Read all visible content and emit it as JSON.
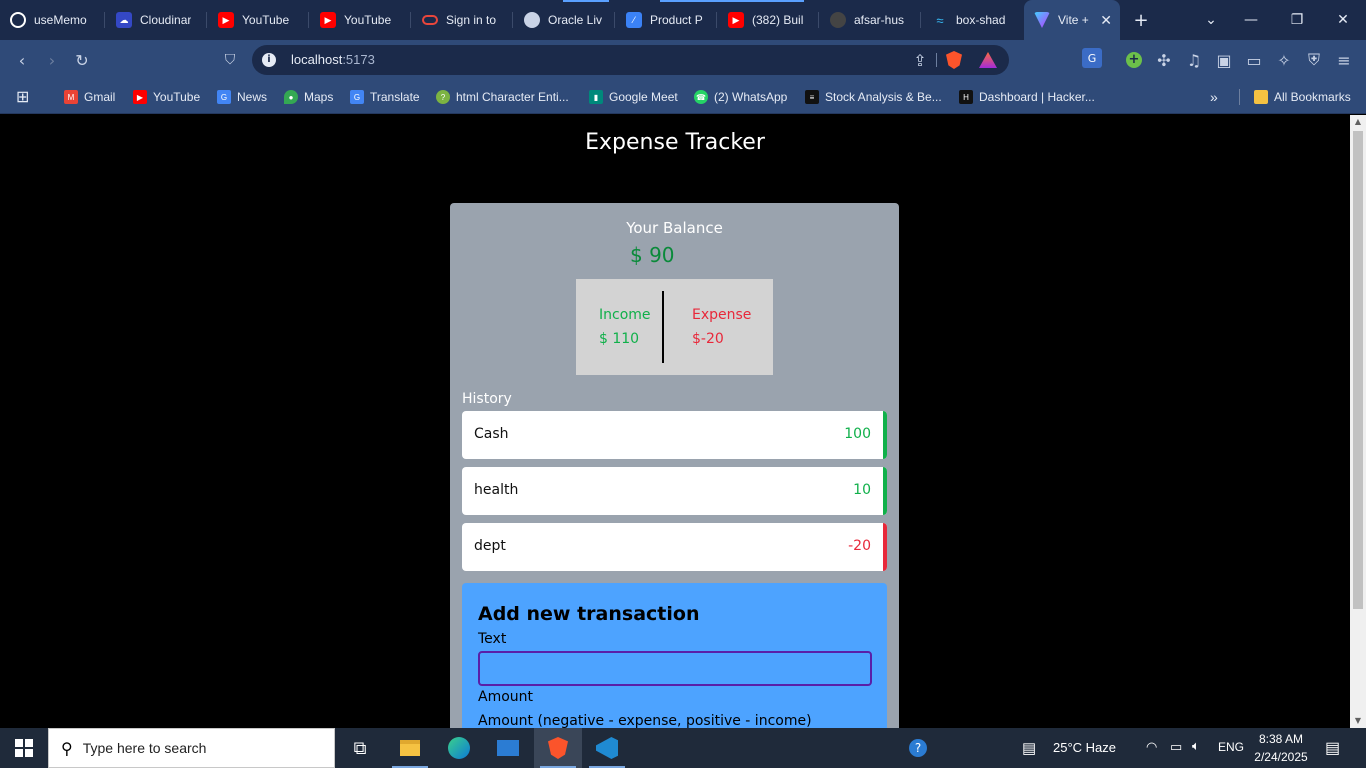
{
  "browser": {
    "tabs": [
      {
        "label": "useMemo",
        "icon": "openai-icon",
        "color": "#ffffff"
      },
      {
        "label": "Cloudinar",
        "icon": "cloudinary-icon",
        "color": "#3448c5"
      },
      {
        "label": "YouTube",
        "icon": "youtube-icon",
        "color": "#ff0000"
      },
      {
        "label": "YouTube",
        "icon": "youtube-icon",
        "color": "#ff0000"
      },
      {
        "label": "Sign in to",
        "icon": "oracle-icon",
        "color": "#e8463c"
      },
      {
        "label": "Oracle Liv",
        "icon": "globe-icon",
        "color": "#c9d3e6"
      },
      {
        "label": "Product P",
        "icon": "product-icon",
        "color": "#3b82f6"
      },
      {
        "label": "(382) Buil",
        "icon": "youtube-icon",
        "color": "#ff0000"
      },
      {
        "label": "afsar-hus",
        "icon": "github-icon",
        "color": "#444444"
      },
      {
        "label": "box-shad",
        "icon": "tailwind-icon",
        "color": "#38bdf8"
      },
      {
        "label": "Vite + ",
        "icon": "vite-icon",
        "color": "#a855f7"
      }
    ],
    "new_tab": "+",
    "address": {
      "host": "localhost",
      "port": ":5173"
    },
    "bookmarks": [
      {
        "label": "Gmail",
        "color": "#ea4335",
        "glyph": "M"
      },
      {
        "label": "YouTube",
        "color": "#ff0000",
        "glyph": "▶"
      },
      {
        "label": "News",
        "color": "#4285f4",
        "glyph": "G"
      },
      {
        "label": "Maps",
        "color": "#34a853",
        "glyph": "●"
      },
      {
        "label": "Translate",
        "color": "#4285f4",
        "glyph": "G"
      },
      {
        "label": "html Character Enti...",
        "color": "#7cb342",
        "glyph": "?"
      },
      {
        "label": "Google Meet",
        "color": "#00897b",
        "glyph": "▮"
      },
      {
        "label": "(2) WhatsApp",
        "color": "#25d366",
        "glyph": "☎"
      },
      {
        "label": "Stock Analysis & Be...",
        "color": "#111111",
        "glyph": "≡"
      },
      {
        "label": "Dashboard | Hacker...",
        "color": "#111111",
        "glyph": "H"
      }
    ],
    "all_bookmarks": "All Bookmarks"
  },
  "app": {
    "title": "Expense Tracker",
    "balance_label": "Your Balance",
    "balance_value": "$ 90",
    "income_label": "Income",
    "income_value": "$ 110",
    "expense_label": "Expense",
    "expense_value": "$-20",
    "history_label": "History",
    "history": [
      {
        "text": "Cash",
        "amount": "100",
        "color": "#10b04a"
      },
      {
        "text": "health",
        "amount": "10",
        "color": "#10b04a"
      },
      {
        "text": "dept",
        "amount": "-20",
        "color": "#e8283a"
      }
    ],
    "add_title": "Add new transaction",
    "text_label": "Text",
    "text_value": "",
    "amount_label": "Amount",
    "amount_hint": "Amount (negative - expense, positive - income)"
  },
  "taskbar": {
    "search_placeholder": "Type here to search",
    "weather": "25°C  Haze",
    "language": "ENG",
    "time": "8:38 AM",
    "date": "2/24/2025"
  }
}
